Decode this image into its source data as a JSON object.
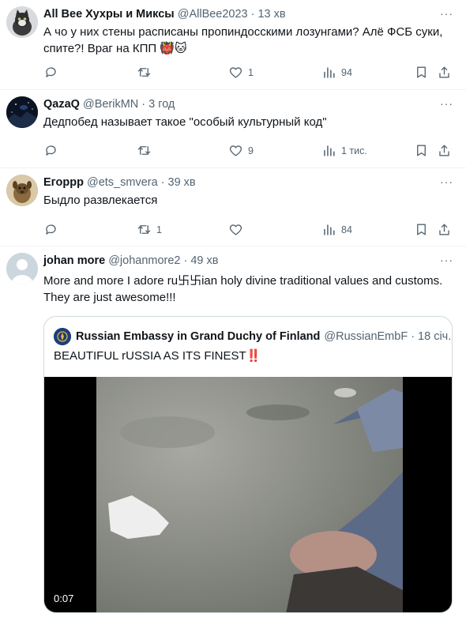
{
  "tweets": [
    {
      "name": "All Bee Хухры и Миксы",
      "handle": "@AllBee2023",
      "time": "13 хв",
      "text_lines": [
        "А чо у них стены расписаны пропиндосскими лозунгами? Алё ФСБ суки,",
        "спите?! Враг на КПП 👹🐱"
      ],
      "reply_count": "",
      "retweet_count": "",
      "like_count": "1",
      "views_count": "94"
    },
    {
      "name": "QazaQ",
      "handle": "@BerikMN",
      "time": "3 год",
      "text_lines": [
        "Дедпобед называет такое \"особый культурный код\""
      ],
      "reply_count": "",
      "retweet_count": "",
      "like_count": "9",
      "views_count": "1 тис."
    },
    {
      "name": "Егоррр",
      "handle": "@ets_smvera",
      "time": "39 хв",
      "text_lines": [
        "Быдло развлекается"
      ],
      "reply_count": "",
      "retweet_count": "1",
      "like_count": "",
      "views_count": "84"
    },
    {
      "name": "johan more",
      "handle": "@johanmore2",
      "time": "49 хв",
      "text_lines": [
        "More and more I adore ru卐卐ian holy divine traditional values and customs.",
        "They are just awesome!!!"
      ]
    }
  ],
  "quote": {
    "name": "Russian Embassy in Grand Duchy of Finland",
    "handle": "@RussianEmbF",
    "time": "18 січ.",
    "text": "BEAUTIFUL rUSSIA AS ITS FINEST‼️",
    "video_duration": "0:07"
  },
  "more_label": "···",
  "dot": "·",
  "icons": [
    "more-icon",
    "reply-icon",
    "retweet-icon",
    "like-icon",
    "views-icon",
    "bookmark-icon",
    "share-icon"
  ],
  "colors": {
    "text": "#0f1419",
    "secondary": "#536471",
    "divider": "#eff3f4",
    "border": "#cfd9de"
  }
}
